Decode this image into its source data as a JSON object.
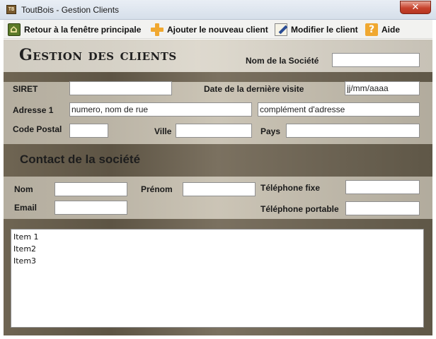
{
  "window": {
    "title": "ToutBois - Gestion Clients",
    "app_icon_text": "TB",
    "close_glyph": "✕"
  },
  "toolbar": {
    "back_label": "Retour à la fenêtre principale",
    "add_label": "Ajouter le nouveau client",
    "edit_label": "Modifier le client",
    "help_label": "Aide",
    "help_glyph": "?"
  },
  "header": {
    "title": "Gestion des clients",
    "company_name_label": "Nom de la Société",
    "company_name_value": ""
  },
  "company": {
    "siret_label": "SIRET",
    "siret_value": "",
    "last_visit_label": "Date de la dernière visite",
    "last_visit_value": "jj/mm/aaaa",
    "address_label": "Adresse 1",
    "address_value": "numero, nom de rue",
    "address2_value": "complément d'adresse",
    "postal_label": "Code Postal",
    "postal_value": "",
    "city_label": "Ville",
    "city_value": "",
    "country_label": "Pays",
    "country_value": ""
  },
  "contact": {
    "section_title": "Contact de la société",
    "lastname_label": "Nom",
    "lastname_value": "",
    "firstname_label": "Prénom",
    "firstname_value": "",
    "phone_label": "Téléphone fixe",
    "phone_value": "",
    "email_label": "Email",
    "email_value": "",
    "mobile_label": "Téléphone portable",
    "mobile_value": ""
  },
  "list": {
    "items": [
      "Item 1",
      "Item2",
      "Item3"
    ]
  }
}
